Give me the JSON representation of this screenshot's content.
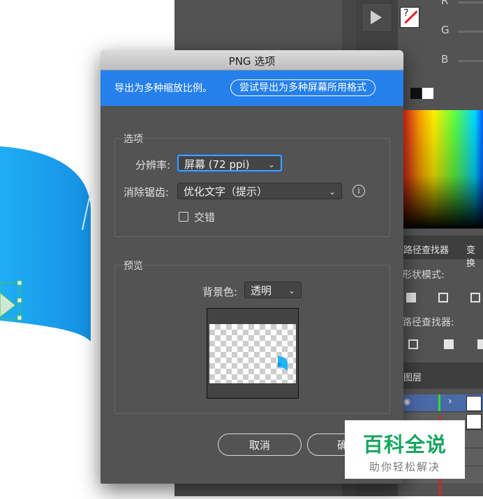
{
  "dialog": {
    "title": "PNG 选项",
    "banner_text": "导出为多种缩放比例。",
    "banner_button": "尝试导出为多种屏幕所用格式",
    "options_group": {
      "title": "选项",
      "resolution_label": "分辨率:",
      "resolution_value": "屏幕 (72 ppi)",
      "antialias_label": "消除锯齿:",
      "antialias_value": "优化文字（提示）",
      "interlace_label": "交错",
      "interlace_checked": false
    },
    "preview_group": {
      "title": "预览",
      "bg_label": "背景色:",
      "bg_value": "透明"
    },
    "cancel_label": "取消",
    "ok_label": "确"
  },
  "right_panel": {
    "channel_r": "R",
    "channel_g": "G",
    "channel_b": "B",
    "swatch_q": "?",
    "tab_pathfinder": "路径查找器",
    "tab_transform": "变换",
    "shape_modes_label": "形状模式:",
    "pathfinders_label": "路径查找器:",
    "layers_tab": "图层"
  },
  "watermark": {
    "title": "百科全说",
    "subtitle": "助你轻松解决"
  },
  "colors": {
    "banner_blue": "#2680eb",
    "focus_blue": "#4b9cf5",
    "artwork_cyan": "#1fb3f7",
    "watermark_green": "#1aa660"
  }
}
